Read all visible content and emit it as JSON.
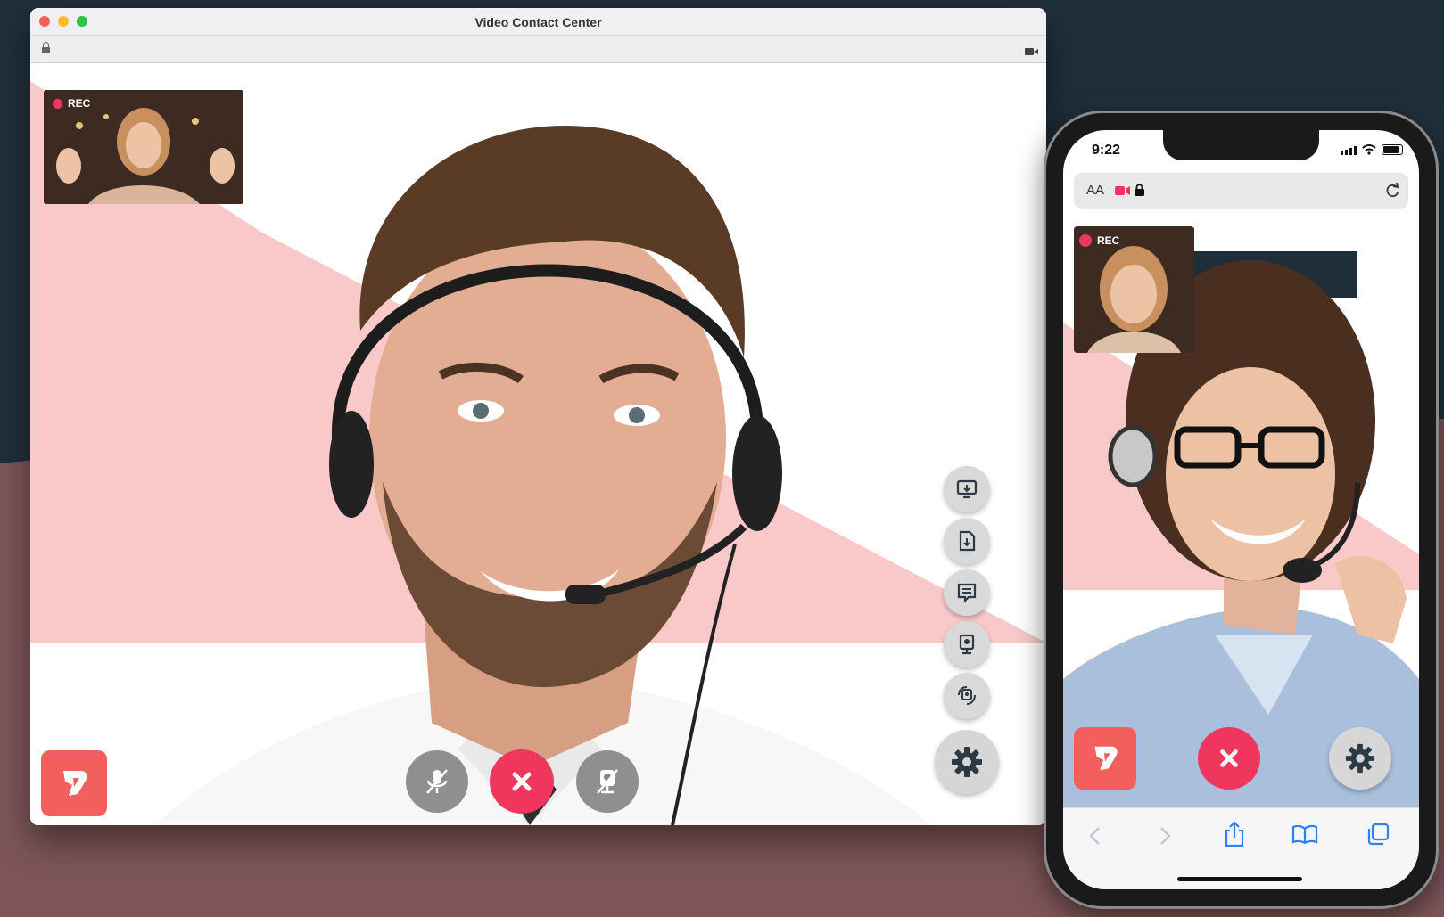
{
  "window": {
    "title": "Video Contact Center",
    "pip_label": "REC"
  },
  "phone": {
    "time": "9:22",
    "address_text_size": "AA",
    "pip_label": "REC"
  },
  "colors": {
    "background_dark": "#1f2f3a",
    "background_rose": "#7d5558",
    "pink_stage": "#f9c9c9",
    "hangup_red": "#f0365c",
    "brand_orange": "#f25f5c",
    "ios_blue": "#2f7ff5"
  },
  "icons": {
    "window_controls": [
      "close-light-icon",
      "minimize-light-icon",
      "zoom-light-icon"
    ],
    "side_tools": [
      "screen-share-icon",
      "document-download-icon",
      "chat-icon",
      "camera-snapshot-icon",
      "switch-camera-icon"
    ],
    "bottom_controls": [
      "mute-microphone-icon",
      "hangup-icon",
      "disable-camera-icon"
    ]
  }
}
